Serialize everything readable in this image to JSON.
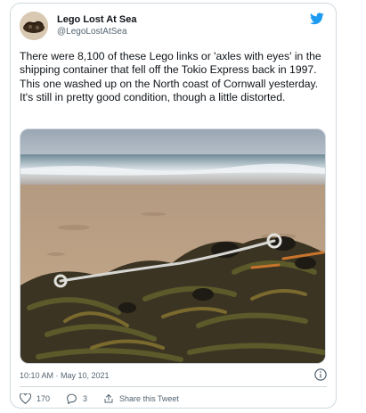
{
  "tweet": {
    "author_name": "Lego Lost At Sea",
    "author_handle": "@LegoLostAtSea",
    "text": "There were 8,100 of these Lego links or 'axles with eyes' in the shipping container that fell off the Tokio Express back in 1997. This one washed up on the North coast of Cornwall yesterday.  It's still in pretty good condition, though a little distorted.",
    "timestamp": "10:10 AM · May 10, 2021",
    "likes": "170",
    "replies": "3",
    "share_label": "Share this Tweet"
  },
  "icons": {
    "brand": "twitter-bird-icon",
    "info": "info-icon",
    "like": "heart-icon",
    "reply": "reply-icon",
    "share": "share-icon"
  },
  "colors": {
    "twitter_blue": "#1d9bf0",
    "muted_text": "#536471",
    "border": "#cfd9de"
  }
}
